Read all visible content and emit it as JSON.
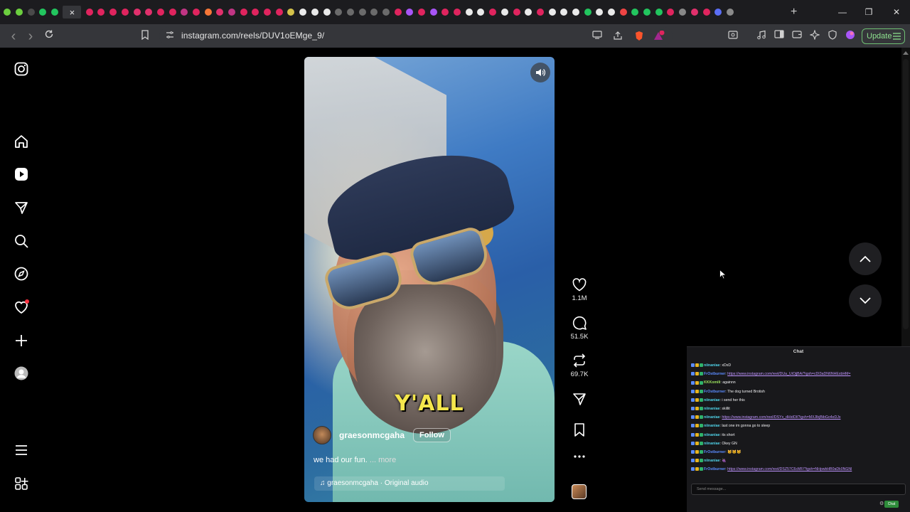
{
  "browser": {
    "tab_favicon_colors": [
      "#6ccf3f",
      "#6ccf3f",
      "#4a4a4a",
      "#22c55e",
      "#22c55e",
      "active",
      "#e0245e",
      "#e0245e",
      "#e0245e",
      "#e0245e",
      "#e1306c",
      "#e1306c",
      "#e0245e",
      "#e0245e",
      "#c13584",
      "#e0245e",
      "#f77737",
      "#e1306c",
      "#c13584",
      "#e0245e",
      "#e0245e",
      "#e0245e",
      "#e0245e",
      "#d4c24a",
      "#eaeaea",
      "#eaeaea",
      "#eaeaea",
      "#6b6b6b",
      "#6b6b6b",
      "#6b6b6b",
      "#6b6b6b",
      "#6b6b6b",
      "#e0245e",
      "#a855f7",
      "#e0245e",
      "#a855f7",
      "#e0245e",
      "#e0245e",
      "#eaeaea",
      "#eaeaea",
      "#e0245e",
      "#eaeaea",
      "#e0245e",
      "#eaeaea",
      "#e0245e",
      "#eaeaea",
      "#eaeaea",
      "#eaeaea",
      "#22c55e",
      "#eaeaea",
      "#eaeaea",
      "#ef4444",
      "#22c55e",
      "#22c55e",
      "#22c55e",
      "#e0245e",
      "#888888",
      "#e1306c",
      "#e0245e",
      "#5b6ef5",
      "#8a8a8a"
    ],
    "active_tab_close": "×",
    "new_tab": "+",
    "url": "instagram.com/reels/DUV1oEMge_9/",
    "update_label": "Update",
    "back_icon": "‹",
    "forward_icon": "›",
    "minimize": "—",
    "maximize": "❐",
    "close": "✕"
  },
  "reel": {
    "caption_overlay": "Y'ALL",
    "username": "graesonmcgaha",
    "follow_label": "Follow",
    "description": "we had our fun.",
    "more_label": "... more",
    "audio": "graesonmcgaha · Original audio"
  },
  "actions": {
    "likes": "1.1M",
    "comments": "51.5K",
    "reposts": "69.7K"
  },
  "chat": {
    "title": "Chat",
    "input_placeholder": "Send message...",
    "send_label": "Chat",
    "messages": [
      {
        "user": "niinaniae",
        "text": "xDxD",
        "color": "#4fd0e6",
        "link": false
      },
      {
        "user": "FrOstburner",
        "text": "https://www.instagram.com/reel/DUa_UiOjjBA/?igsh=cDI3aDN6NHExbHM=",
        "color": "#5b8cff",
        "link": true
      },
      {
        "user": "KKKomili",
        "text": "againnn",
        "color": "#9be15d",
        "link": false
      },
      {
        "user": "FrOstburner",
        "text": "The dog turned Brotish",
        "color": "#5b8cff",
        "link": false
      },
      {
        "user": "niinaniae",
        "text": "i send her this",
        "color": "#4fd0e6",
        "link": false
      },
      {
        "user": "niinaniae",
        "text": "skillit",
        "color": "#4fd0e6",
        "link": false
      },
      {
        "user": "niinaniae",
        "text": "https://www.instagram.com/reel/DSYx_dHidOl/?igsh=MXJlbjBibGo4eDJx",
        "color": "#4fd0e6",
        "link": true
      },
      {
        "user": "niinaniae",
        "text": "last one im gonna go to sleep",
        "color": "#4fd0e6",
        "link": false
      },
      {
        "user": "niinaniae",
        "text": "its short",
        "color": "#4fd0e6",
        "link": false
      },
      {
        "user": "niinaniae",
        "text": "Okey GN",
        "color": "#4fd0e6",
        "link": false
      },
      {
        "user": "FrOstburner",
        "text": "🐱🐱🐱",
        "color": "#5b8cff",
        "link": false
      },
      {
        "user": "niinaniae",
        "text": "🍇",
        "color": "#4fd0e6",
        "link": false
      },
      {
        "user": "FrOstburner",
        "text": "https://www.instagram.com/reel/DSZ57C6cMF/?igsh=NHpwbHB0aDk0NGNl",
        "color": "#5b8cff",
        "link": true
      }
    ]
  }
}
